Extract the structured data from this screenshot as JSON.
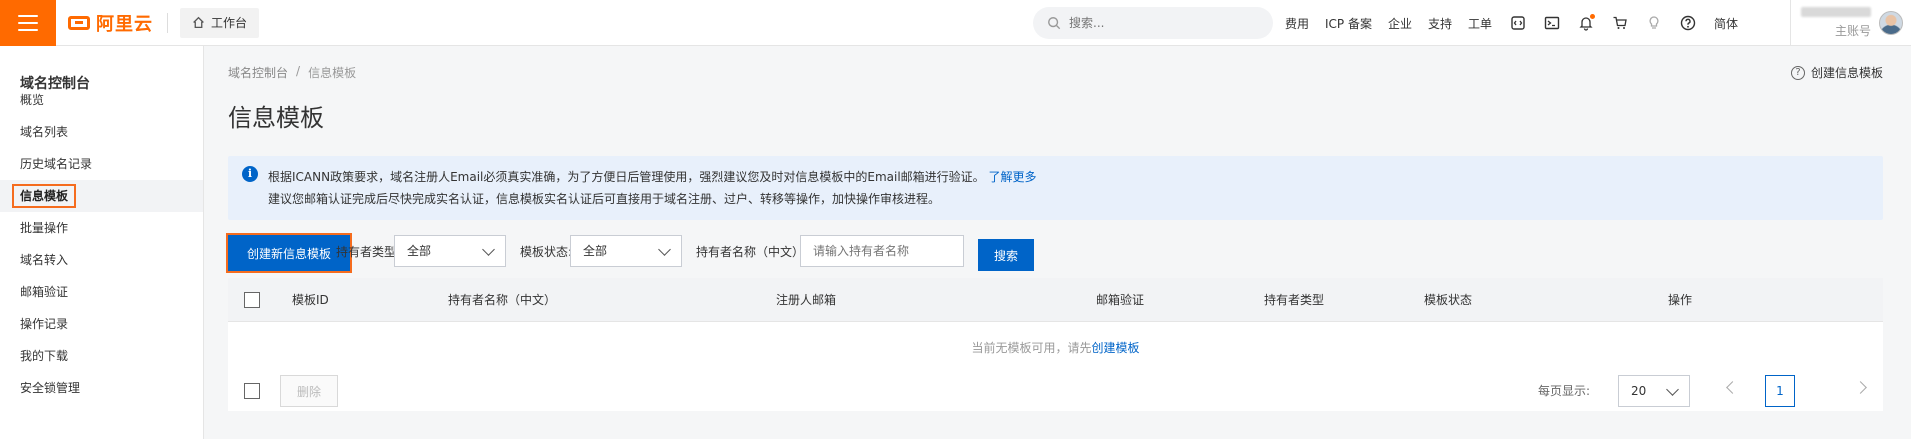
{
  "topbar": {
    "logo_text": "阿里云",
    "workbench_label": "工作台",
    "search_placeholder": "搜索...",
    "links": [
      "费用",
      "ICP 备案",
      "企业",
      "支持",
      "工单"
    ],
    "language": "简体",
    "account_role": "主账号",
    "accent_color": "#ff6a00"
  },
  "sidebar": {
    "title": "域名控制台",
    "items": [
      {
        "label": "概览"
      },
      {
        "label": "域名列表"
      },
      {
        "label": "历史域名记录"
      },
      {
        "label": "信息模板",
        "active": true
      },
      {
        "label": "批量操作"
      },
      {
        "label": "域名转入"
      },
      {
        "label": "邮箱验证"
      },
      {
        "label": "操作记录"
      },
      {
        "label": "我的下载"
      },
      {
        "label": "安全锁管理"
      }
    ]
  },
  "breadcrumb": {
    "root": "域名控制台",
    "separator": "/",
    "current": "信息模板"
  },
  "help_link": "创建信息模板",
  "page_title": "信息模板",
  "notice": {
    "line1": "根据ICANN政策要求，域名注册人Email必须真实准确，为了方便日后管理使用，强烈建议您及时对信息模板中的Email邮箱进行验证。",
    "learn_more": "了解更多",
    "line2": "建议您邮箱认证完成后尽快完成实名认证，信息模板实名认证后可直接用于域名注册、过户、转移等操作，加快操作审核进程。"
  },
  "filters": {
    "create_button": "创建新信息模板",
    "holder_type_label": "持有者类型:",
    "holder_type_value": "全部",
    "status_label": "模板状态:",
    "status_value": "全部",
    "holder_name_label": "持有者名称（中文）:",
    "holder_name_placeholder": "请输入持有者名称",
    "search_button": "搜索"
  },
  "table": {
    "columns": [
      "模板ID",
      "持有者名称（中文）",
      "注册人邮箱",
      "邮箱验证",
      "持有者类型",
      "模板状态",
      "操作"
    ],
    "empty_text": "当前无模板可用，请先",
    "empty_link": "创建模板"
  },
  "footer": {
    "delete_button": "删除",
    "page_size_label": "每页显示:",
    "page_size_value": "20",
    "current_page": "1"
  }
}
